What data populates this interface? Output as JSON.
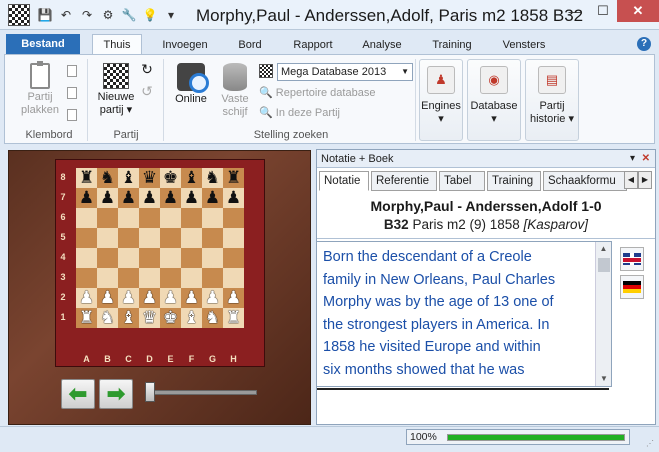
{
  "window": {
    "title": "Morphy,Paul - Anderssen,Adolf, Paris m2 1858  B32",
    "minimize": "—",
    "maximize": "☐",
    "close": "✕"
  },
  "quick_access": {
    "save_icon": "💾",
    "undo_icon": "↶",
    "redo_icon": "↷",
    "gear_icon": "⚙",
    "tool_icon": "🔧",
    "bulb_icon": "💡",
    "more_icon": "▾"
  },
  "tabs": [
    "Bestand",
    "Thuis",
    "Invoegen",
    "Bord",
    "Rapport",
    "Analyse",
    "Training",
    "Vensters"
  ],
  "help": "?",
  "ribbon": {
    "clipboard": {
      "paste_label_1": "Partij",
      "paste_label_2": "plakken",
      "group": "Klembord"
    },
    "game": {
      "new_label_1": "Nieuwe",
      "new_label_2": "partij ▾",
      "group": "Partij"
    },
    "search": {
      "online": "Online",
      "fixed_1": "Vaste",
      "fixed_2": "schijf",
      "database_value": "Mega Database 2013",
      "repertoire": "Repertoire database",
      "in_game": "In deze Partij",
      "group": "Stelling zoeken"
    },
    "big_buttons": [
      {
        "label_1": "Engines",
        "label_2": "▾"
      },
      {
        "label_1": "Database",
        "label_2": "▾"
      },
      {
        "label_1": "Partij",
        "label_2": "historie ▾"
      }
    ]
  },
  "board": {
    "ranks": [
      "8",
      "7",
      "6",
      "5",
      "4",
      "3",
      "2",
      "1"
    ],
    "files": [
      "A",
      "B",
      "C",
      "D",
      "E",
      "F",
      "G",
      "H"
    ],
    "position": [
      [
        "r",
        "n",
        "b",
        "q",
        "k",
        "b",
        "n",
        "r"
      ],
      [
        "p",
        "p",
        "p",
        "p",
        "p",
        "p",
        "p",
        "p"
      ],
      [
        "",
        "",
        "",
        "",
        "",
        "",
        "",
        ""
      ],
      [
        "",
        "",
        "",
        "",
        "",
        "",
        "",
        ""
      ],
      [
        "",
        "",
        "",
        "",
        "",
        "",
        "",
        ""
      ],
      [
        "",
        "",
        "",
        "",
        "",
        "",
        "",
        ""
      ],
      [
        "P",
        "P",
        "P",
        "P",
        "P",
        "P",
        "P",
        "P"
      ],
      [
        "R",
        "N",
        "B",
        "Q",
        "K",
        "B",
        "N",
        "R"
      ]
    ],
    "back_icon": "⬅",
    "forward_icon": "➡"
  },
  "pane": {
    "title": "Notatie + Boek",
    "menu_icon": "▾",
    "close_icon": "✕",
    "tabs": [
      "Notatie",
      "Referentie",
      "Tabel",
      "Training",
      "Schaakformu"
    ],
    "tab_prev": "◀",
    "tab_next": "▶",
    "header_line1": "Morphy,Paul - Anderssen,Adolf  1-0",
    "eco": "B32",
    "event": "Paris m2 (9) 1858",
    "annotator": "[Kasparov]",
    "body_lines": [
      "Born the descendant of a Creole",
      "family in New Orleans, Paul Charles",
      "Morphy was by the age of 13 one of",
      "the strongest players in America. In",
      "1858 he visited Europe and within",
      "six months showed that he was"
    ],
    "scroll_up": "▲",
    "scroll_down": "▼"
  },
  "status": {
    "zoom_label": "100%",
    "progress": 1.0
  },
  "colors": {
    "accent": "#2b6fb8",
    "progress": "#22b022",
    "notation_text": "#1b4fa8"
  }
}
